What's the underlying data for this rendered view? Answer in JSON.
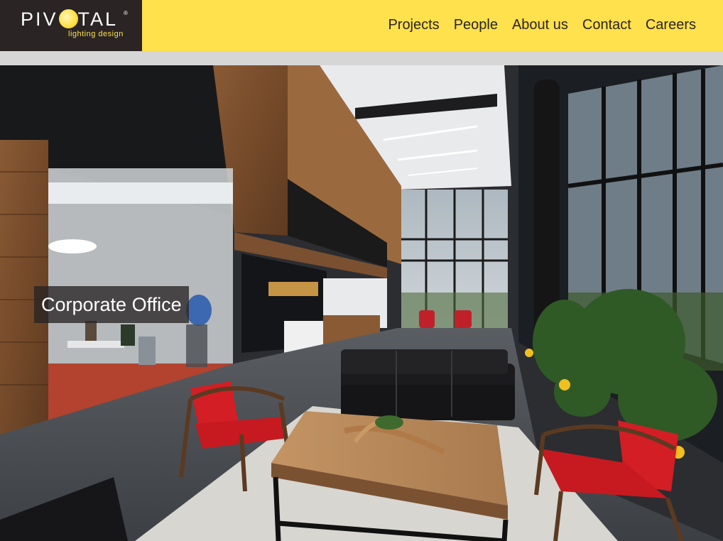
{
  "brand": {
    "logo_text": "PIV",
    "logo_text_end": "TAL",
    "registered": "®",
    "tagline": "lighting design",
    "colors": {
      "header_bg": "#ffe04d",
      "logo_bg": "#2a2424"
    }
  },
  "nav": {
    "items": [
      {
        "label": "Projects"
      },
      {
        "label": "People"
      },
      {
        "label": "About us"
      },
      {
        "label": "Contact"
      },
      {
        "label": "Careers"
      }
    ]
  },
  "hero": {
    "caption": "Corporate Office",
    "image_icon": "photo-of-corporate-office-lobby"
  }
}
